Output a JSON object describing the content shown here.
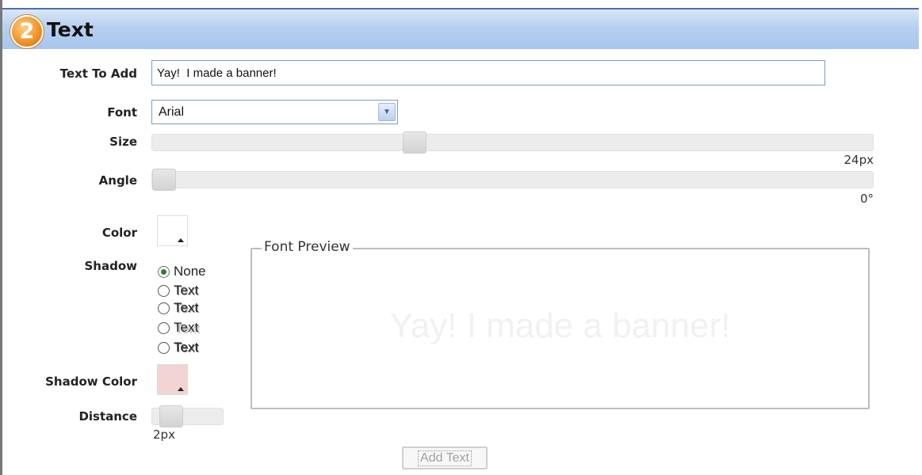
{
  "header": {
    "step_number": "2",
    "title": "Text"
  },
  "form": {
    "text_to_add_label": "Text To Add",
    "text_to_add_value": "Yay!  I made a banner!",
    "font_label": "Font",
    "font_value": "Arial",
    "size_label": "Size",
    "size_value": "24px",
    "size_fraction": 0.36,
    "angle_label": "Angle",
    "angle_value": "0°",
    "angle_fraction": 0.0,
    "color_label": "Color",
    "color_value": "#ffffff",
    "shadow_label": "Shadow",
    "shadow_options": [
      {
        "label": "None",
        "checked": true
      },
      {
        "label": "Text",
        "checked": false
      },
      {
        "label": "Text",
        "checked": false
      },
      {
        "label": "Text",
        "checked": false
      },
      {
        "label": "Text",
        "checked": false
      }
    ],
    "shadow_color_label": "Shadow Color",
    "shadow_color_value": "#f2d4d4",
    "distance_label": "Distance",
    "distance_value": "2px",
    "distance_fraction": 0.15
  },
  "preview": {
    "legend": "Font Preview",
    "text": "Yay!  I made a banner!"
  },
  "actions": {
    "add_text_label": "Add Text"
  }
}
